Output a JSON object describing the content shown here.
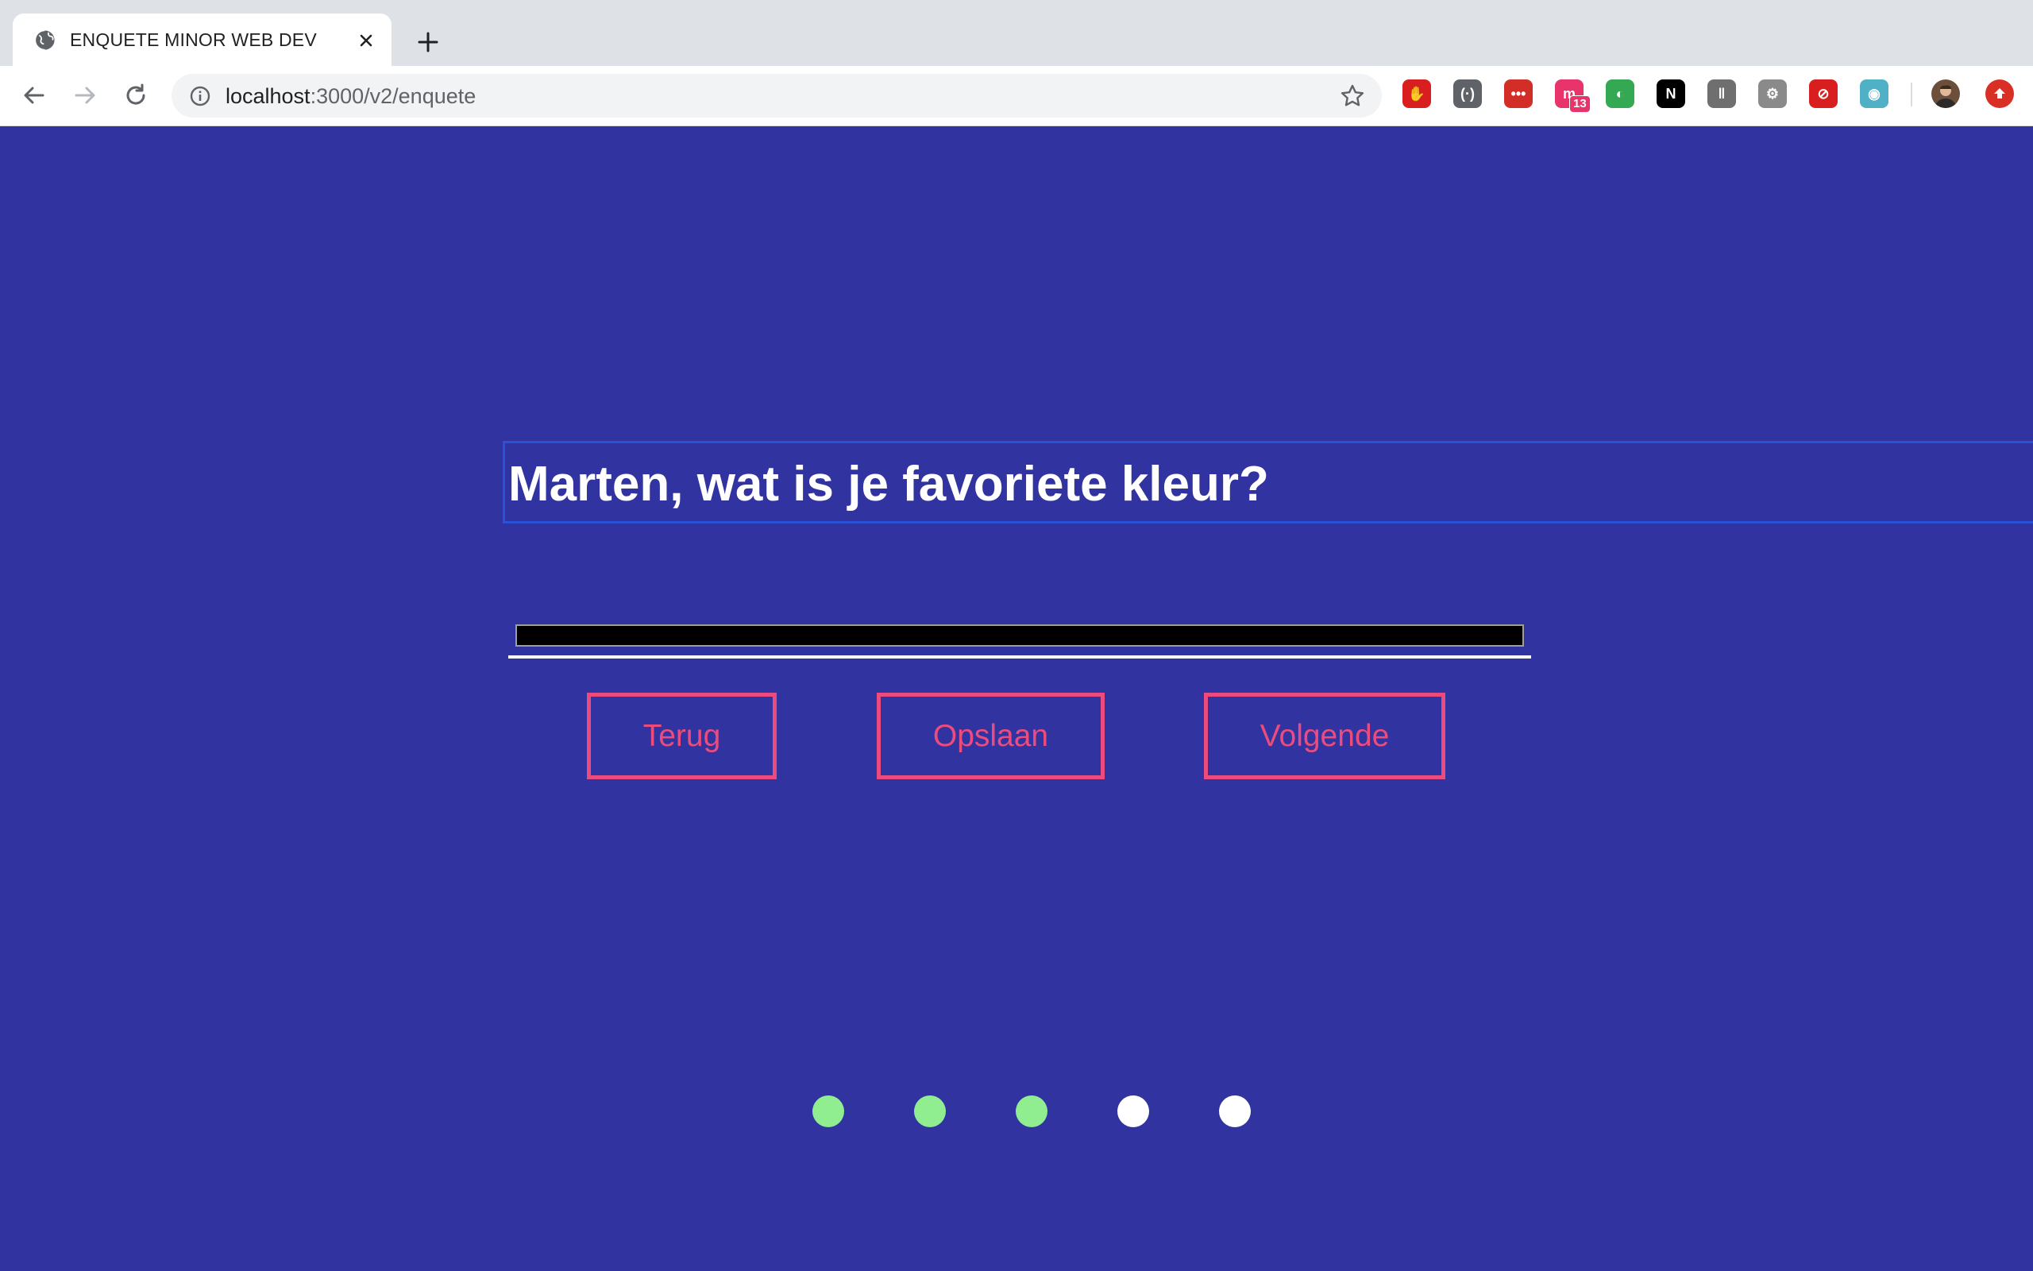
{
  "browser": {
    "tab": {
      "title": "ENQUETE MINOR WEB DEV"
    },
    "url": {
      "host": "localhost",
      "path": ":3000/v2/enquete"
    },
    "extensions": [
      {
        "name": "ublock-icon",
        "color": "#d81e1e",
        "glyph": "✋"
      },
      {
        "name": "devtools-extension-icon",
        "color": "#5f6368",
        "glyph": "(·)"
      },
      {
        "name": "lastpass-icon",
        "color": "#d32d27",
        "glyph": "•••"
      },
      {
        "name": "mail-extension-icon",
        "color": "#e8336b",
        "glyph": "m",
        "badge": "13"
      },
      {
        "name": "color-picker-icon",
        "color": "#34a853",
        "glyph": "◐"
      },
      {
        "name": "notion-icon",
        "color": "#000000",
        "glyph": "N"
      },
      {
        "name": "library-extension-icon",
        "color": "#6f6f6f",
        "glyph": "‖"
      },
      {
        "name": "gear-extension-icon",
        "color": "#8a8a8a",
        "glyph": "⚙"
      },
      {
        "name": "blocker-icon",
        "color": "#d81e1e",
        "glyph": "⊘"
      },
      {
        "name": "eye-extension-icon",
        "color": "#4fb0c6",
        "glyph": "◉"
      }
    ]
  },
  "survey": {
    "question": "Marten, wat is je favoriete kleur?",
    "answer_value": "",
    "buttons": {
      "back": "Terug",
      "save": "Opslaan",
      "next": "Volgende"
    },
    "progress": {
      "total_steps": 5,
      "completed_steps": 3,
      "completed_color": "#90ee90",
      "pending_color": "#ffffff"
    }
  },
  "colors": {
    "background": "#3133a0",
    "accent": "#ec4c7d",
    "question_focus": "#2a52d6"
  }
}
